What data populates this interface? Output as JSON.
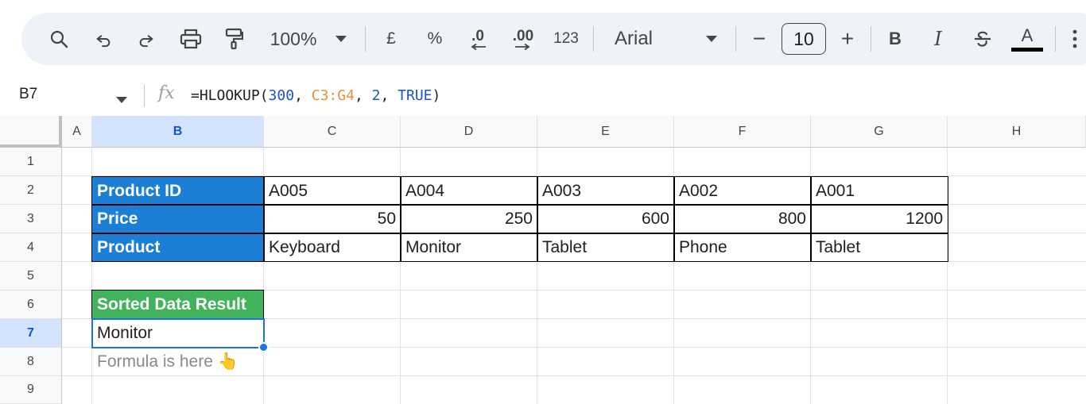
{
  "toolbar": {
    "zoom": "100%",
    "currency": "£",
    "percent": "%",
    "decrease_decimal": ".0",
    "increase_decimal": ".00",
    "number_format": "123",
    "font": "Arial",
    "font_size": "10",
    "minus": "−",
    "plus": "+",
    "bold": "B",
    "italic": "I",
    "text_color": "A",
    "icons": [
      "search-icon",
      "undo-icon",
      "redo-icon",
      "print-icon",
      "paint-format-icon",
      "zoom-dropdown-icon",
      "font-dropdown-icon",
      "strikethrough-icon",
      "more-icon"
    ]
  },
  "formula_bar": {
    "name_box": "B7",
    "fx": "fx",
    "formula": {
      "prefix": "=HLOOKUP(",
      "arg1": "300",
      "sep1": ", ",
      "arg2": "C3:G4",
      "sep2": ", ",
      "arg3": "2",
      "sep3": ", ",
      "arg4": "TRUE",
      "suffix": ")"
    }
  },
  "columns": [
    "A",
    "B",
    "C",
    "D",
    "E",
    "F",
    "G",
    "H"
  ],
  "rows": [
    "1",
    "2",
    "3",
    "4",
    "5",
    "6",
    "7",
    "8",
    "9"
  ],
  "selected_column": "B",
  "selected_row": "7",
  "table": {
    "row_labels": [
      "Product ID",
      "Price",
      "Product"
    ],
    "ids": [
      "A005",
      "A004",
      "A003",
      "A002",
      "A001"
    ],
    "prices": [
      "50",
      "250",
      "600",
      "800",
      "1200"
    ],
    "products": [
      "Keyboard",
      "Monitor",
      "Tablet",
      "Phone",
      "Tablet"
    ]
  },
  "result": {
    "header": "Sorted Data Result",
    "value": "Monitor",
    "note": "Formula is here 👆"
  },
  "colors": {
    "header_blue": "#1c7fd6",
    "header_green": "#41b35a",
    "selection": "#1a73e8"
  }
}
